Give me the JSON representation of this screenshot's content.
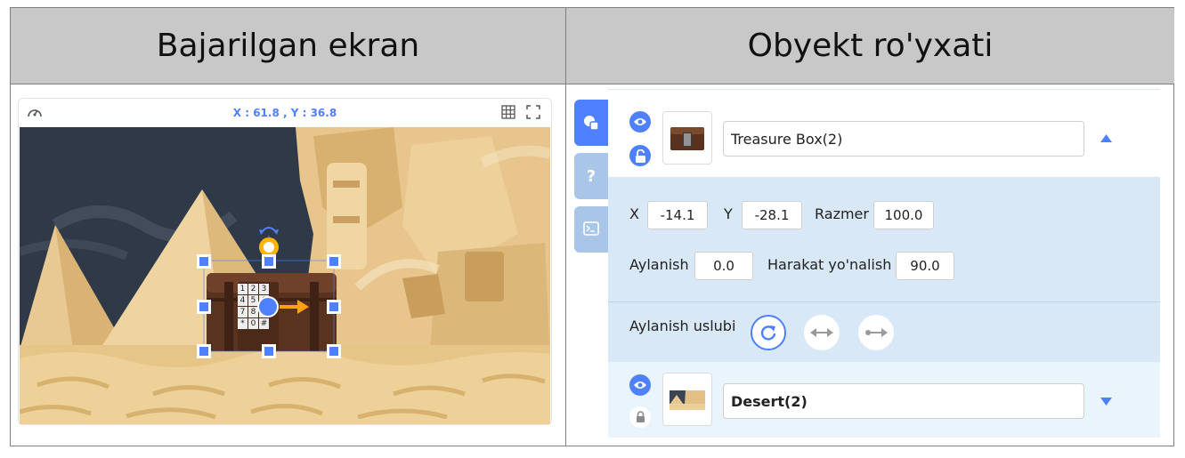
{
  "headers": {
    "left": "Bajarilgan ekran",
    "right": "Obyekt ro'yxati"
  },
  "stage": {
    "coords": "X : 61.8 , Y : 36.8"
  },
  "objects": [
    {
      "name": "Treasure Box(2)",
      "thumb_icon": "treasure-chest-thumbnail",
      "collapse_icon": "triangle-up-icon",
      "lock_icon": "lock-open-icon"
    },
    {
      "name": "Desert(2)",
      "thumb_icon": "desert-thumbnail",
      "collapse_icon": "triangle-down-icon",
      "lock_icon": "lock-closed-icon"
    }
  ],
  "props": {
    "x_label": "X",
    "x_value": "-14.1",
    "y_label": "Y",
    "y_value": "-28.1",
    "size_label": "Razmer",
    "size_value": "100.0",
    "rotation_label": "Aylanish",
    "rotation_value": "0.0",
    "direction_label": "Harakat yo'nalish",
    "direction_value": "90.0",
    "rotation_style_label": "Aylanish uslubi"
  },
  "keypad": [
    "1",
    "2",
    "3",
    "4",
    "5",
    "6",
    "7",
    "8",
    "9",
    "*",
    "0",
    "#"
  ],
  "colors": {
    "accent": "#4f80ff",
    "handle": "#4f80ff",
    "rotate_handle": "#ffb400",
    "arrow": "#ff9f1a"
  }
}
